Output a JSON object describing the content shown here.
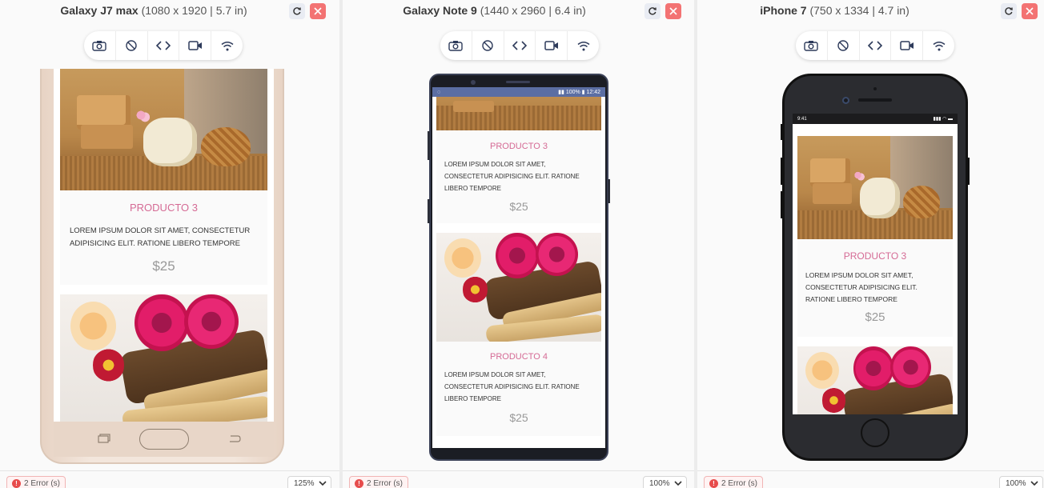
{
  "panels": [
    {
      "device_name": "Galaxy J7 max",
      "device_spec": "(1080 x 1920 | 5.7 in)",
      "errors": "2 Error (s)",
      "zoom": "125%"
    },
    {
      "device_name": "Galaxy Note 9",
      "device_spec": "(1440 x 2960 | 6.4 in)",
      "errors": "2 Error (s)",
      "zoom": "100%"
    },
    {
      "device_name": "iPhone 7",
      "device_spec": "(750 x 1334 | 4.7 in)",
      "errors": "2 Error (s)",
      "zoom": "100%"
    }
  ],
  "toolbar": {
    "icons": [
      "camera-icon",
      "rotate-icon",
      "code-icon",
      "video-icon",
      "wifi-icon"
    ]
  },
  "products": [
    {
      "title": "PRODUCTO 3",
      "description": "LOREM IPSUM DOLOR SIT AMET, CONSECTETUR ADIPISICING ELIT. RATIONE LIBERO TEMPORE",
      "price": "$25"
    },
    {
      "title": "PRODUCTO 4",
      "description": "LOREM IPSUM DOLOR SIT AMET, CONSECTETUR ADIPISICING ELIT. RATIONE LIBERO TEMPORE",
      "price": "$25"
    }
  ],
  "status_bars": {
    "note9": {
      "battery": "100%",
      "time": "12:42"
    },
    "iphone": {
      "time": "9:41"
    }
  },
  "colors": {
    "product_title": "#d56b95",
    "close_button": "#f37373",
    "error_dot": "#e74c4c",
    "note9_status_bar": "#5b6ea3"
  }
}
